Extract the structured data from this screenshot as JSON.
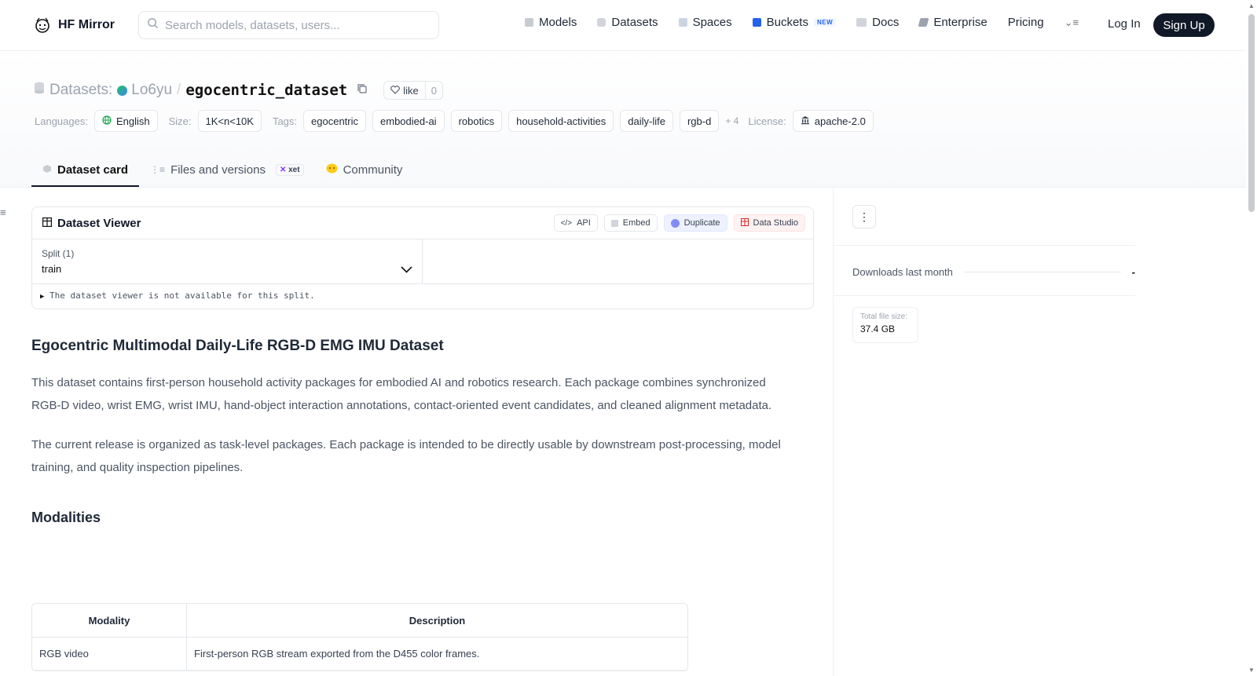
{
  "nav": {
    "brand": "HF Mirror",
    "search_placeholder": "Search models, datasets, users...",
    "links": [
      {
        "label": "Models",
        "icon": "cube-icon"
      },
      {
        "label": "Datasets",
        "icon": "database-icon"
      },
      {
        "label": "Spaces",
        "icon": "grid-icon"
      },
      {
        "label": "Buckets",
        "icon": "bucket-icon",
        "badge": "NEW"
      },
      {
        "label": "Docs",
        "icon": "book-icon"
      },
      {
        "label": "Enterprise",
        "icon": "enterprise-icon"
      },
      {
        "label": "Pricing"
      }
    ],
    "login": "Log In",
    "signup": "Sign Up"
  },
  "repo": {
    "type_label": "Datasets:",
    "owner": "Lo6yu",
    "separator": "/",
    "name": "egocentric_dataset",
    "like_label": "like",
    "like_count": "0"
  },
  "meta": {
    "languages_label": "Languages:",
    "language": "English",
    "size_label": "Size:",
    "size": "1K<n<10K",
    "tags_label": "Tags:",
    "tags": [
      "egocentric",
      "embodied-ai",
      "robotics",
      "household-activities",
      "daily-life",
      "rgb-d"
    ],
    "more_tags": "+ 4",
    "license_label": "License:",
    "license": "apache-2.0"
  },
  "tabs": {
    "card": "Dataset card",
    "files": "Files and versions",
    "xet": "xet",
    "community": "Community"
  },
  "viewer": {
    "title": "Dataset Viewer",
    "api": "API",
    "embed": "Embed",
    "duplicate": "Duplicate",
    "studio": "Data Studio",
    "split_label": "Split (1)",
    "split_value": "train",
    "not_available": "The dataset viewer is not available for this split."
  },
  "content": {
    "heading": "Egocentric Multimodal Daily-Life RGB-D EMG IMU Dataset",
    "para1": "This dataset contains first-person household activity packages for embodied AI and robotics research. Each package combines synchronized RGB-D video, wrist EMG, wrist IMU, hand-object interaction annotations, contact-oriented event candidates, and cleaned alignment metadata.",
    "para2": "The current release is organized as task-level packages. Each package is intended to be directly usable by downstream post-processing, model training, and quality inspection pipelines.",
    "modalities_heading": "Modalities",
    "table_headers": [
      "Modality",
      "Description"
    ],
    "table_rows": [
      [
        "RGB video",
        "First-person RGB stream exported from the D455 color frames."
      ]
    ]
  },
  "rail": {
    "downloads_label": "Downloads last month",
    "downloads_value": "-",
    "filesize_label": "Total file size:",
    "filesize_value": "37.4 GB"
  }
}
